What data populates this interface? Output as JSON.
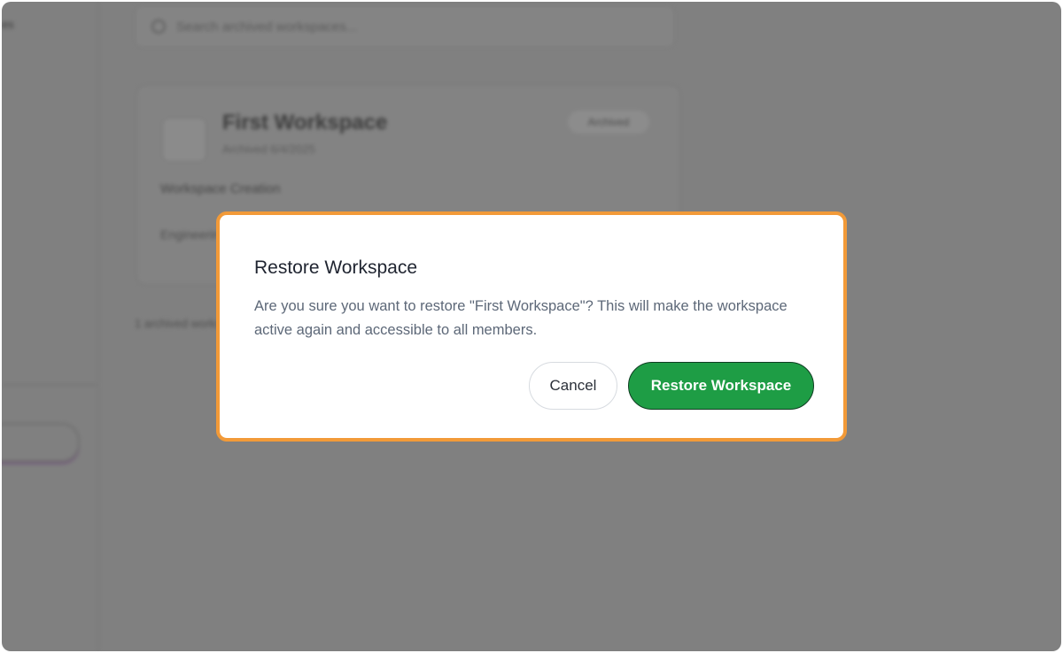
{
  "background": {
    "sidebar_label": "es",
    "search_placeholder": "Search archived workspaces...",
    "card": {
      "title": "First Workspace",
      "archived_date": "Archived 6/4/2025",
      "badge": "Archived",
      "description": "Workspace Creation",
      "footer": "Engineering"
    },
    "count_text": "1 archived workspace"
  },
  "dialog": {
    "title": "Restore Workspace",
    "message": "Are you sure you want to restore \"First Workspace\"? This will make the workspace active again and accessible to all members.",
    "cancel_label": "Cancel",
    "confirm_label": "Restore Workspace"
  },
  "colors": {
    "highlight_outline": "#f29a38",
    "confirm_button": "#1e9d45",
    "overlay": "#808080"
  }
}
